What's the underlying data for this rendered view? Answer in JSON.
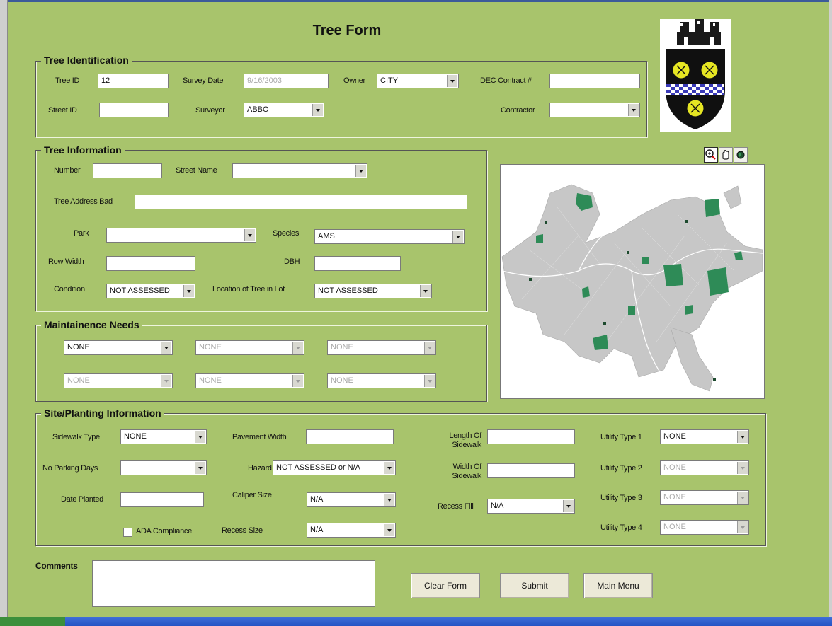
{
  "form_title": "Tree Form",
  "tree_identification": {
    "legend": "Tree Identification",
    "tree_id_label": "Tree ID",
    "tree_id_value": "12",
    "survey_date_label": "Survey Date",
    "survey_date_value": "9/16/2003",
    "owner_label": "Owner",
    "owner_value": "CITY",
    "dec_contract_label": "DEC Contract #",
    "dec_contract_value": "",
    "street_id_label": "Street ID",
    "street_id_value": "",
    "surveyor_label": "Surveyor",
    "surveyor_value": "ABBO",
    "contractor_label": "Contractor",
    "contractor_value": ""
  },
  "tree_information": {
    "legend": "Tree Information",
    "number_label": "Number",
    "number_value": "",
    "street_name_label": "Street Name",
    "street_name_value": "",
    "address_bad_label": "Tree Address Bad",
    "address_bad_value": "",
    "park_label": "Park",
    "park_value": "",
    "species_label": "Species",
    "species_value": "AMS",
    "row_width_label": "Row Width",
    "row_width_value": "",
    "dbh_label": "DBH",
    "dbh_value": "",
    "condition_label": "Condition",
    "condition_value": "NOT ASSESSED",
    "location_label": "Location of Tree in Lot",
    "location_value": "NOT ASSESSED"
  },
  "maintenance_needs": {
    "legend": "Maintainence Needs",
    "needs": [
      "NONE",
      "NONE",
      "NONE",
      "NONE",
      "NONE",
      "NONE"
    ]
  },
  "site_planting": {
    "legend": "Site/Planting Information",
    "sidewalk_type_label": "Sidewalk Type",
    "sidewalk_type_value": "NONE",
    "pavement_width_label": "Pavement Width",
    "pavement_width_value": "",
    "length_sidewalk_label_1": "Length Of",
    "length_sidewalk_label_2": "Sidewalk",
    "length_sidewalk_value": "",
    "utility_type_1_label": "Utility Type 1",
    "utility_type_1_value": "NONE",
    "no_parking_days_label": "No Parking Days",
    "no_parking_days_value": "",
    "hazard_label": "Hazard",
    "hazard_value": "NOT ASSESSED or N/A",
    "width_sidewalk_label_1": "Width Of",
    "width_sidewalk_label_2": "Sidewalk",
    "width_sidewalk_value": "",
    "utility_type_2_label": "Utility Type 2",
    "utility_type_2_value": "NONE",
    "date_planted_label": "Date Planted",
    "date_planted_value": "",
    "caliper_size_label": "Caliper Size",
    "caliper_size_value": "N/A",
    "recess_fill_label": "Recess Fill",
    "recess_fill_value": "N/A",
    "utility_type_3_label": "Utility Type 3",
    "utility_type_3_value": "NONE",
    "ada_compliance_label": "ADA Compliance",
    "ada_compliance_checked": false,
    "recess_size_label": "Recess Size",
    "recess_size_value": "N/A",
    "utility_type_4_label": "Utility Type 4",
    "utility_type_4_value": "NONE"
  },
  "comments": {
    "label": "Comments",
    "value": ""
  },
  "buttons": {
    "clear_form": "Clear Form",
    "submit": "Submit",
    "main_menu": "Main Menu"
  },
  "map_tools": [
    "zoom-in-icon",
    "pan-hand-icon",
    "globe-icon"
  ],
  "colors": {
    "background": "#a8c46c",
    "map_parks": "#2e8b57",
    "map_streets": "#c8c8c8"
  }
}
